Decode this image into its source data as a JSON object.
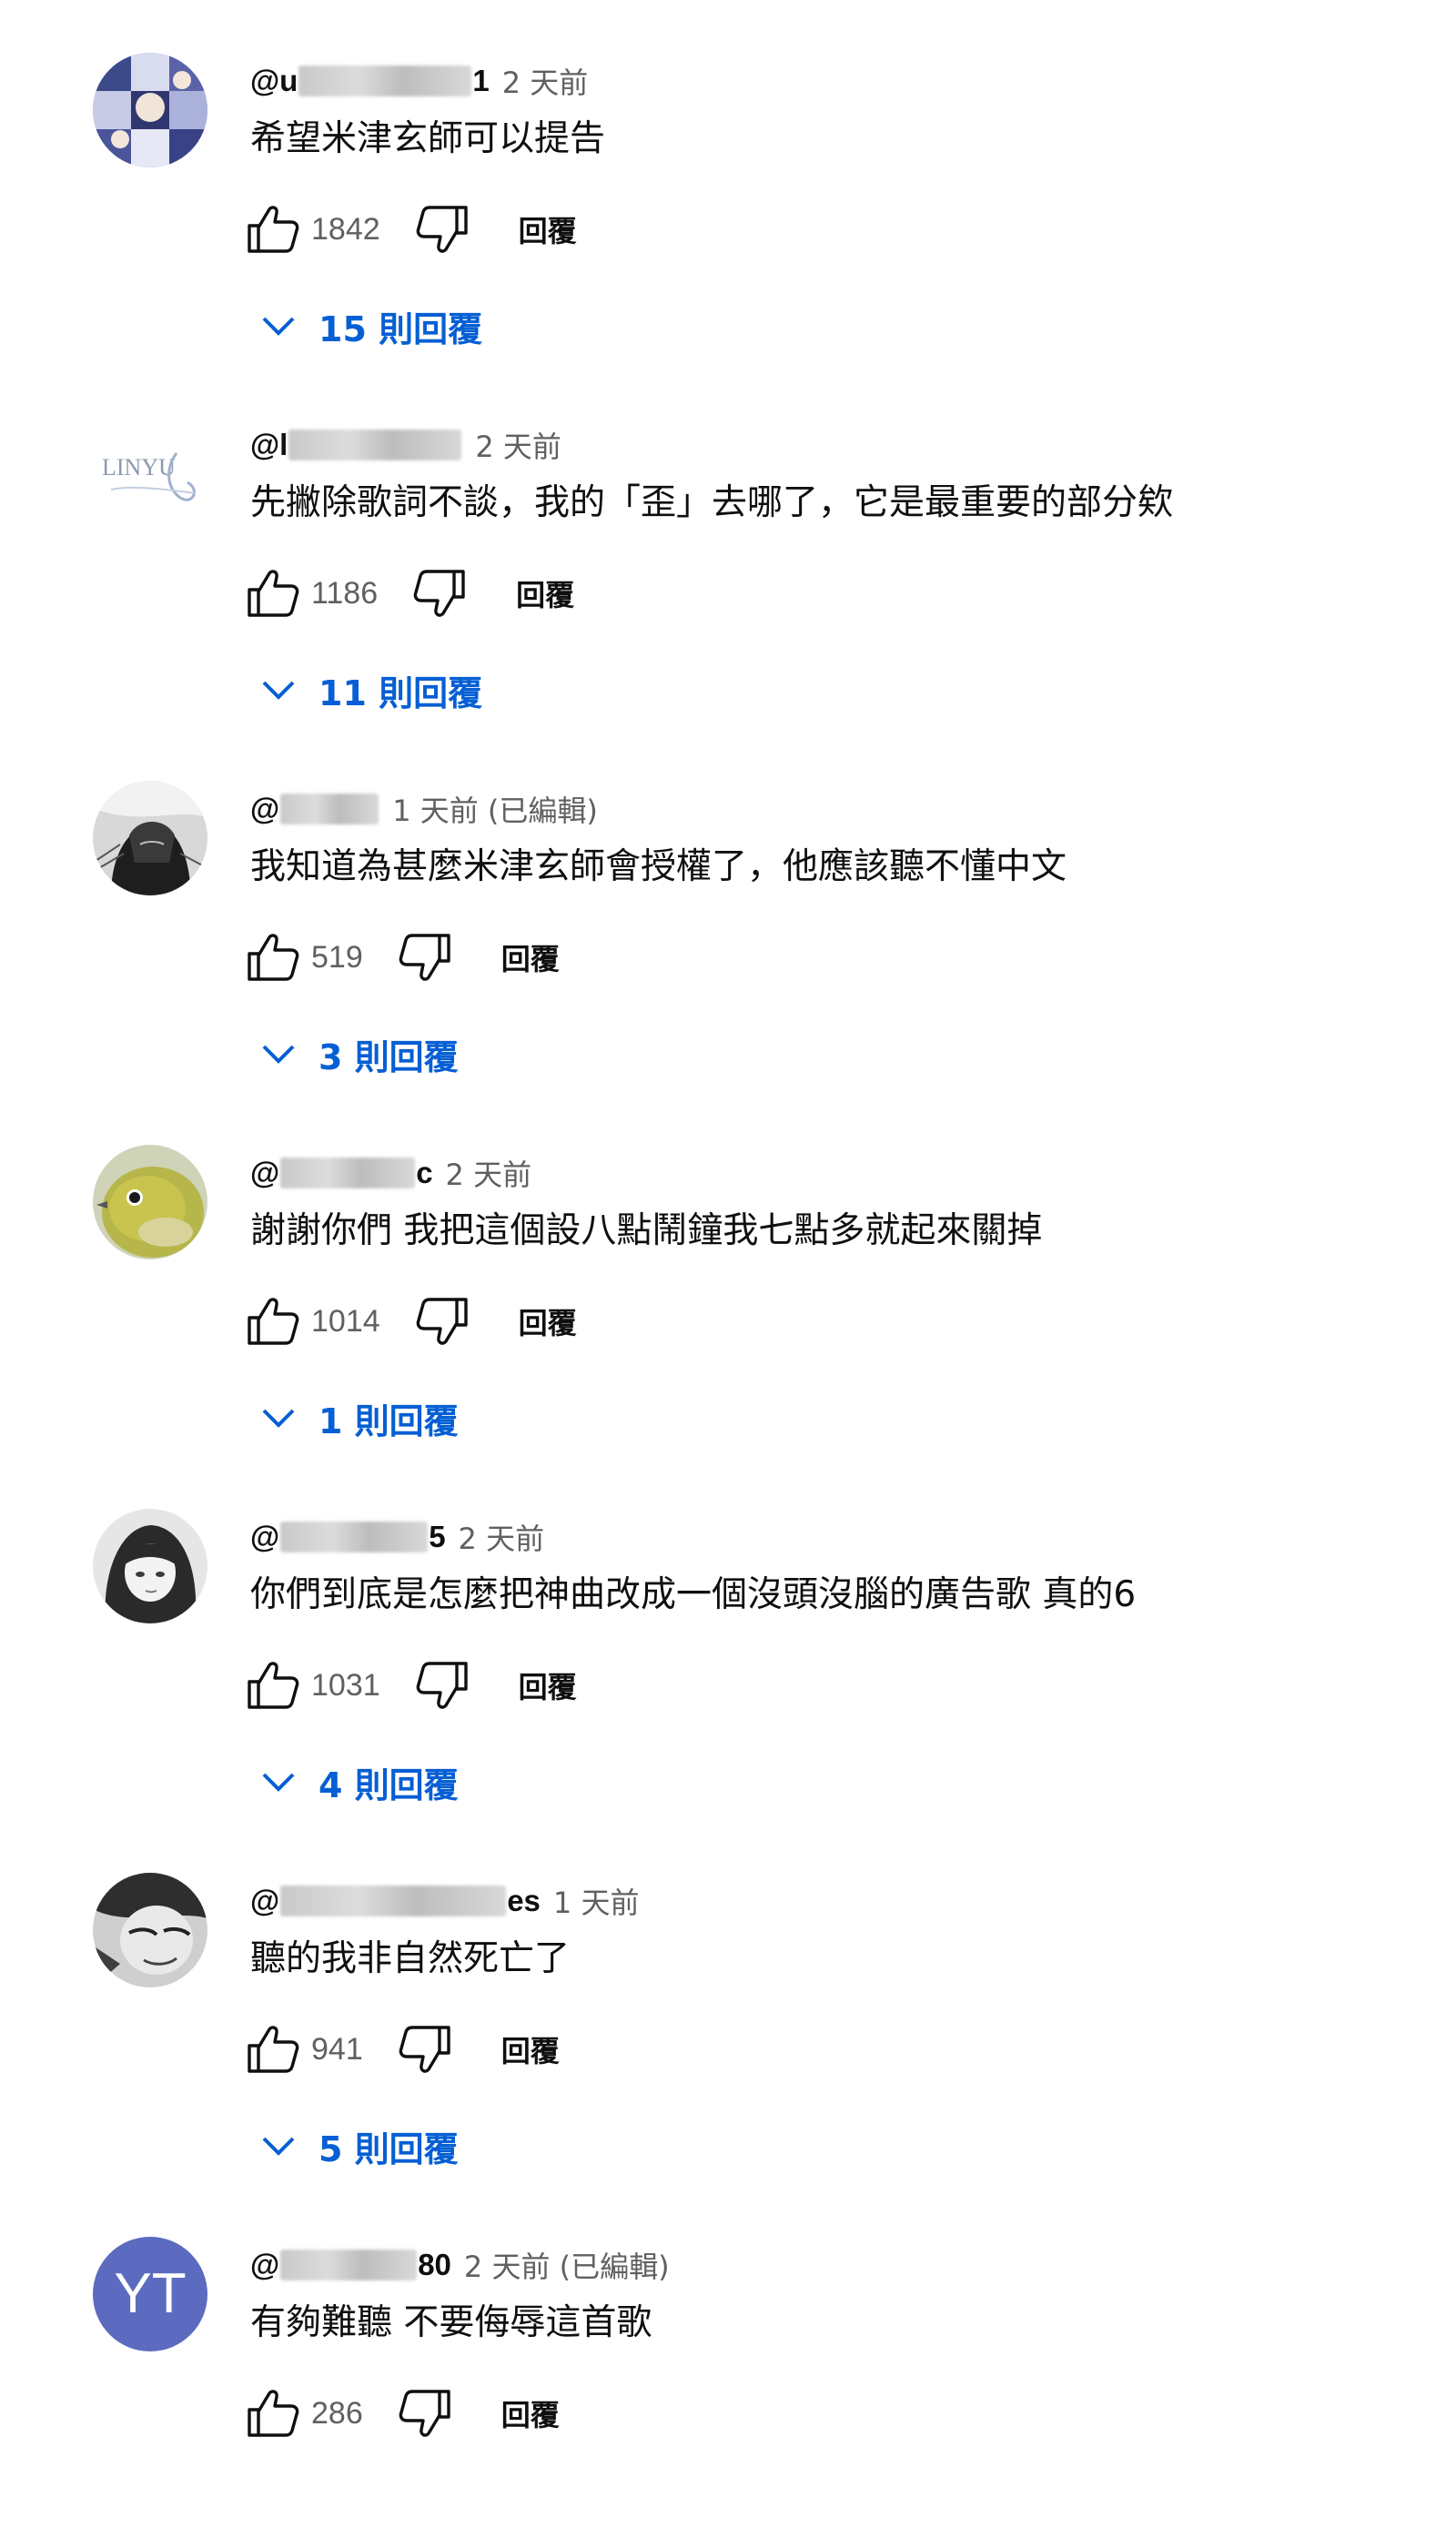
{
  "reply_label": "回覆",
  "colors": {
    "link_blue": "#065fd4",
    "secondary_text": "#606060",
    "primary_text": "#0f0f0f",
    "avatar_yt_bg": "#5c6bc0"
  },
  "comments": [
    {
      "author_prefix": "@u",
      "author_suffix": "1",
      "time": "2 天前",
      "text": "希望米津玄師可以提告",
      "likes": "1842",
      "replies": "15 則回覆",
      "avatar_icon": "anime-collage-avatar"
    },
    {
      "author_prefix": "@l",
      "author_suffix": "",
      "time": "2 天前",
      "text": "先撇除歌詞不談，我的「歪」去哪了，它是最重要的部分欸",
      "likes": "1186",
      "replies": "11 則回覆",
      "avatar_icon": "logo-avatar",
      "avatar_text": "LINYU"
    },
    {
      "author_prefix": "@",
      "author_suffix": "",
      "time": "1 天前 (已編輯)",
      "text": "我知道為甚麼米津玄師會授權了，他應該聽不懂中文",
      "likes": "519",
      "replies": "3 則回覆",
      "avatar_icon": "manga-portrait-avatar"
    },
    {
      "author_prefix": "@",
      "author_suffix": "c",
      "time": "2 天前",
      "text": "謝謝你們 我把這個設八點鬧鐘我七點多就起來關掉",
      "likes": "1014",
      "replies": "1 則回覆",
      "avatar_icon": "bird-avatar"
    },
    {
      "author_prefix": "@",
      "author_suffix": "5",
      "time": "2 天前",
      "text": "你們到底是怎麼把神曲改成一個沒頭沒腦的廣告歌 真的6",
      "likes": "1031",
      "replies": "4 則回覆",
      "avatar_icon": "anime-girl-avatar"
    },
    {
      "author_prefix": "@",
      "author_suffix": "es",
      "time": "1 天前",
      "text": "聽的我非自然死亡了",
      "likes": "941",
      "replies": "5 則回覆",
      "avatar_icon": "manga-face-avatar"
    },
    {
      "author_prefix": "@",
      "author_suffix": "80",
      "time": "2 天前 (已編輯)",
      "text": "有夠難聽 不要侮辱這首歌",
      "likes": "286",
      "replies": "",
      "avatar_icon": "initials-avatar",
      "avatar_text": "YT"
    }
  ]
}
